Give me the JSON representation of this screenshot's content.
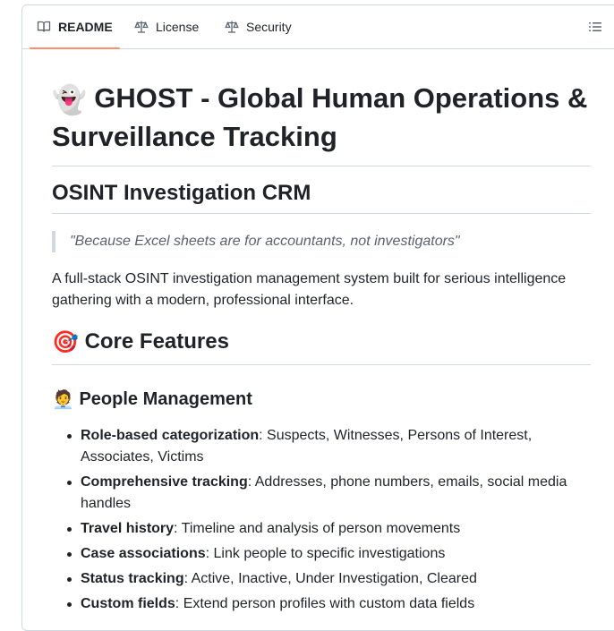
{
  "tabs": [
    {
      "label": "README",
      "icon": "book-icon",
      "active": true
    },
    {
      "label": "License",
      "icon": "scale-icon",
      "active": false
    },
    {
      "label": "Security",
      "icon": "scale-icon",
      "active": false
    }
  ],
  "toc_icon": "list-unordered-icon",
  "readme": {
    "title_emoji": "👻",
    "title": "GHOST - Global Human Operations & Surveillance Tracking",
    "subtitle": "OSINT Investigation CRM",
    "quote": "\"Because Excel sheets are for accountants, not investigators\"",
    "description": "A full-stack OSINT investigation management system built for serious intelligence gathering with a modern, professional interface.",
    "features_emoji": "🎯",
    "features_heading": "Core Features",
    "people_emoji": "🧑‍💼",
    "people_heading": "People Management",
    "items": [
      {
        "term": "Role-based categorization",
        "text": ": Suspects, Witnesses, Persons of Interest, Associates, Victims"
      },
      {
        "term": "Comprehensive tracking",
        "text": ": Addresses, phone numbers, emails, social media handles"
      },
      {
        "term": "Travel history",
        "text": ": Timeline and analysis of person movements"
      },
      {
        "term": "Case associations",
        "text": ": Link people to specific investigations"
      },
      {
        "term": "Status tracking",
        "text": ": Active, Inactive, Under Investigation, Cleared"
      },
      {
        "term": "Custom fields",
        "text": ": Extend person profiles with custom data fields"
      }
    ]
  },
  "colors": {
    "active_tab_underline": "#fd8c73",
    "border": "#d1d9e0",
    "text": "#1f2328",
    "muted": "#59636e"
  }
}
